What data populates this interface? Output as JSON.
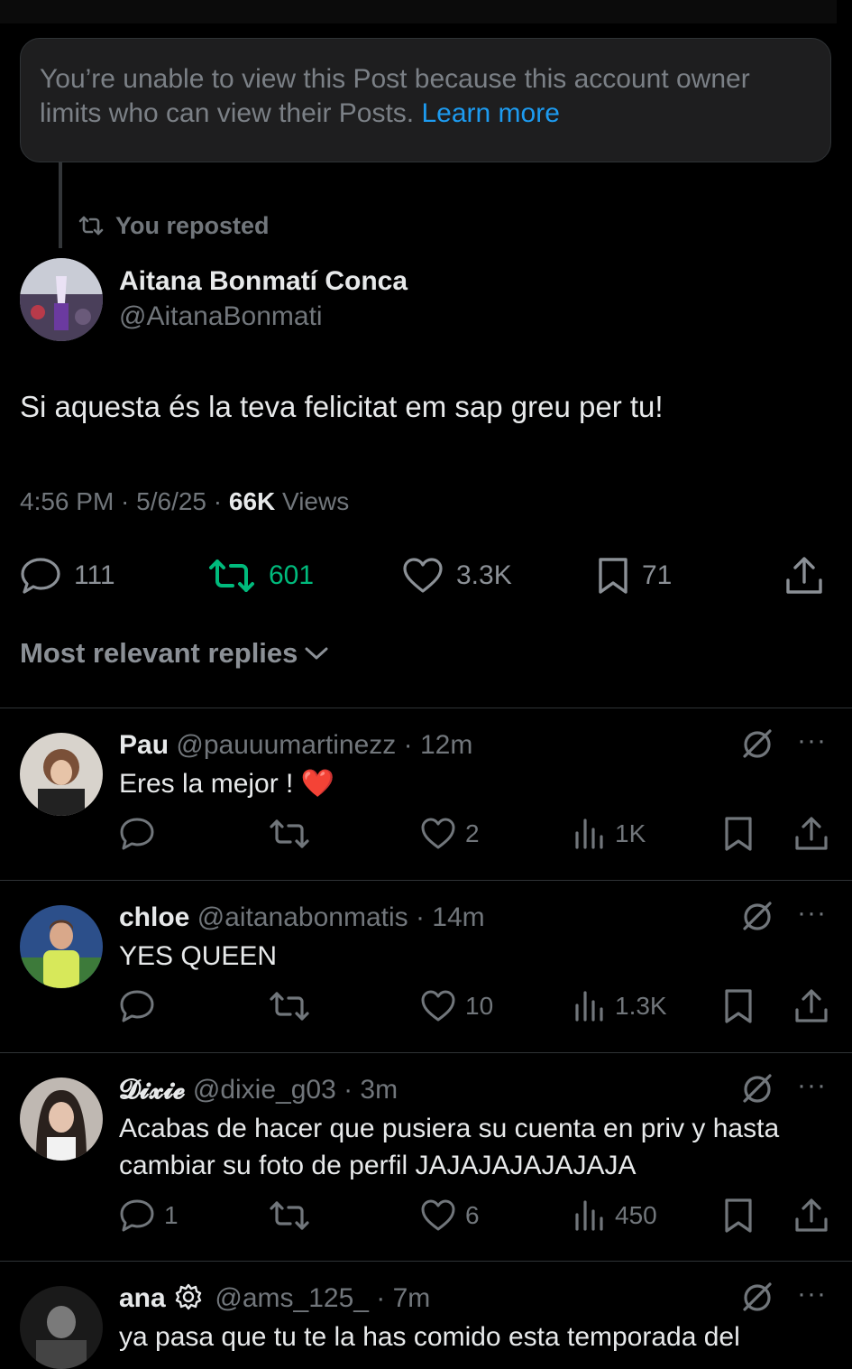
{
  "notice": {
    "text": "You’re unable to view this Post because this account owner limits who can view their Posts.",
    "link": "Learn more"
  },
  "repost_label": "You reposted",
  "post": {
    "author_name": "Aitana Bonmatí Conca",
    "author_handle": "@AitanaBonmati",
    "text": "Si aquesta és la teva felicitat em sap greu per tu!",
    "time": "4:56 PM · 5/6/25 · ",
    "views_count": "66K",
    "views_label": " Views",
    "replies": "111",
    "reposts": "601",
    "likes": "3.3K",
    "bookmarks": "71"
  },
  "sort_label": "Most relevant replies",
  "replies": [
    {
      "name": "Pau",
      "handle": "@pauuumartinezz · 12m",
      "text": "Eres la mejor ! ❤️",
      "replies": "",
      "likes": "2",
      "views": "1K"
    },
    {
      "name": "chloe",
      "handle": "@aitanabonmatis · 14m",
      "text": "YES QUEEN",
      "replies": "",
      "likes": "10",
      "views": "1.3K"
    },
    {
      "name": "𝓓𝓲𝔁𝓲𝓮",
      "handle": "@dixie_g03 · 3m",
      "text": "Acabas de hacer que pusiera su cuenta en priv y hasta cambiar su foto de perfil JAJAJAJAJAJAJA",
      "replies": "1",
      "likes": "6",
      "views": "450"
    },
    {
      "name": "ana",
      "handle": "@ams_125_ · 7m",
      "text": "ya pasa que tu te la has comido esta temporada del",
      "replies": "",
      "likes": "",
      "views": ""
    }
  ],
  "more_glyph": "···",
  "colors": {
    "background": "#000000",
    "accent": "#1d9bf0",
    "repost_green": "#00ba7c",
    "muted": "#71767b",
    "heart_red": "#e0245e"
  }
}
